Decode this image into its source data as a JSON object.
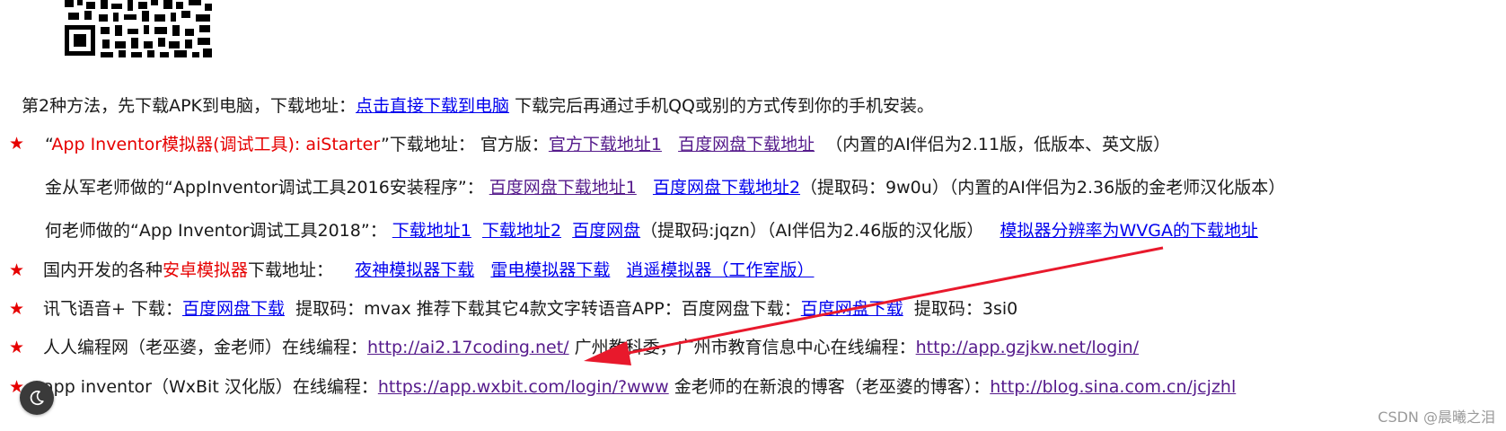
{
  "lines": {
    "l1": {
      "prefix": "第2种方法，先下载APK到电脑，下载地址：",
      "link": "点击直接下载到电脑",
      "suffix": " 下载完后再通过手机QQ或别的方式传到你的手机安装。"
    },
    "l2": {
      "star": "★",
      "quote_open": "“",
      "title_red": "App Inventor模拟器(调试工具): aiStarter",
      "text1": "”下载地址：  官方版：",
      "link1": "官方下载地址1",
      "link2": "百度网盘下载地址",
      "suffix": "（内置的AI伴侣为2.11版，低版本、英文版）"
    },
    "l3": {
      "prefix": "金从军老师做的“AppInventor调试工具2016安装程序”：",
      "link1": "百度网盘下载地址1",
      "link2": "百度网盘下载地址2",
      "suffix": "（提取码：9w0u）（内置的AI伴侣为2.36版的金老师汉化版本）"
    },
    "l4": {
      "prefix": "何老师做的“App Inventor调试工具2018”：",
      "link1": "下载地址1",
      "link2": "下载地址2",
      "link3": "百度网盘",
      "mid": "（提取码:jqzn）（AI伴侣为2.46版的汉化版）",
      "link4": "模拟器分辨率为WVGA的下载地址"
    },
    "l5": {
      "star": "★",
      "prefix": "国内开发的各种",
      "red": "安卓模拟器",
      "text": "下载地址：",
      "link1": "夜神模拟器下载",
      "link2": "雷电模拟器下载",
      "link3": "逍遥模拟器（工作室版）"
    },
    "l6": {
      "star": "★",
      "prefix": "讯飞语音+ 下载：",
      "link1": "百度网盘下载",
      "mid": "提取码：mvax  推荐下载其它4款文字转语音APP：百度网盘下载：",
      "link2": "百度网盘下载",
      "suffix": "提取码：3si0"
    },
    "l7": {
      "star": "★",
      "prefix": "人人编程网（老巫婆，金老师）在线编程：",
      "link1": "http://ai2.17coding.net/",
      "mid": "  广州教科委，广州市教育信息中心在线编程：",
      "link2": "http://app.gzjkw.net/login/"
    },
    "l8": {
      "star": "★",
      "prefix": "app inventor（WxBit 汉化版）在线编程：",
      "link1": "https://app.wxbit.com/login/?www",
      "mid": "  金老师的在新浪的博客（老巫婆的博客）：",
      "link2": "http://blog.sina.com.cn/jcjzhl"
    }
  },
  "watermark": "CSDN @晨曦之泪",
  "colors": {
    "link": "#0000ee",
    "visited": "#551a8b",
    "accent_red": "#e60000",
    "arrow": "#e8192c"
  },
  "icons": {
    "theme_toggle": "moon-icon",
    "qr": "qr-code-icon"
  }
}
